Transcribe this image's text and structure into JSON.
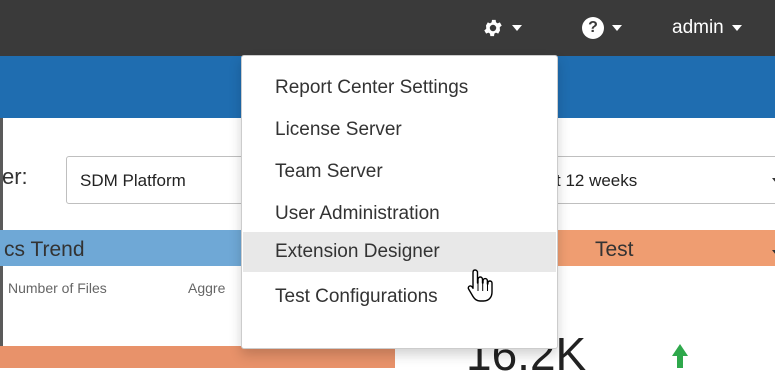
{
  "topbar": {
    "settings_icon": "gear-icon",
    "help_icon": "question-circle-icon",
    "help_glyph": "?",
    "user_label": "admin"
  },
  "filter": {
    "label": "er:",
    "project_value": "SDM Platform",
    "range_value": "t 12 weeks"
  },
  "widgets": {
    "trend": {
      "title": "cs Trend",
      "subtitle_left": "Number of Files",
      "subtitle_right": "Aggre"
    },
    "test": {
      "title": "Test",
      "metric": "16.2K"
    }
  },
  "settings_menu": {
    "items": [
      {
        "label": "Report Center Settings"
      },
      {
        "label": "License Server"
      },
      {
        "label": "Team Server"
      },
      {
        "label": "User Administration"
      },
      {
        "label": "Extension Designer"
      },
      {
        "label": "Test Configurations"
      }
    ],
    "hovered_item": "Extension Designer"
  },
  "colors": {
    "topbar": "#3a3a3a",
    "brand_blue": "#1f6db0",
    "trend_header": "#6fa8d6",
    "test_header": "#ef9d71",
    "up_arrow": "#2ea84b"
  }
}
